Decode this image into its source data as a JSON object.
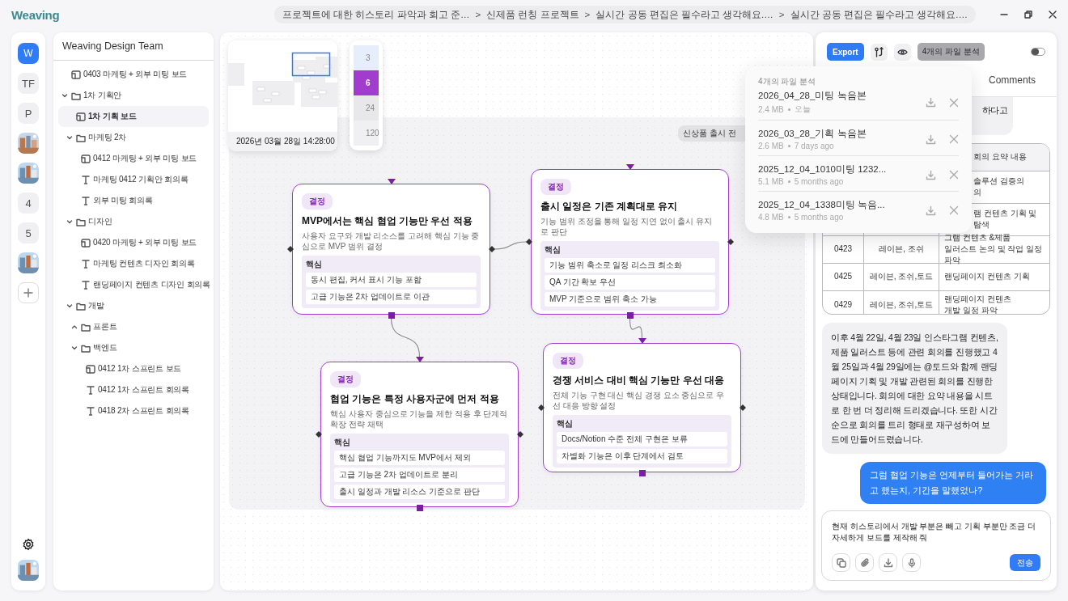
{
  "app": {
    "logo": "Weaving"
  },
  "breadcrumb": [
    {
      "label": "프로젝트에 대한 히스토리 파악과 회고 준…"
    },
    {
      "separator": ">",
      "label": "신제품 런칭 프로젝트"
    },
    {
      "separator": ">",
      "label": "실시간 공동 편집은 필수라고 생각해요.…"
    },
    {
      "separator": ">",
      "label": "실시간 공동 편집은 필수라고 생각해요.…"
    }
  ],
  "rail": {
    "items": [
      {
        "kind": "text",
        "label": "W",
        "selected": true
      },
      {
        "kind": "text",
        "label": "TF",
        "selected": false
      },
      {
        "kind": "text",
        "label": "P",
        "selected": false
      },
      {
        "kind": "picture",
        "selected": false
      },
      {
        "kind": "picture",
        "selected": false
      },
      {
        "kind": "text",
        "label": "4",
        "selected": false
      },
      {
        "kind": "text",
        "label": "5",
        "selected": false
      },
      {
        "kind": "picture",
        "selected": false
      },
      {
        "kind": "add"
      }
    ]
  },
  "tree": {
    "title": "Weaving Design Team",
    "items": [
      {
        "kind": "board",
        "label": "0403 마케팅 + 외부 미팅 보드",
        "selected": false
      },
      {
        "kind": "folder",
        "label": "1차 기획안",
        "expanded": true,
        "selected": false,
        "children": [
          {
            "kind": "board",
            "label": "1차 기획 보드",
            "selected": true
          },
          {
            "kind": "folder",
            "label": "마케팅 2차",
            "expanded": true,
            "selected": false,
            "children": [
              {
                "kind": "board",
                "label": "0412 마케팅 + 외부 미팅 보드",
                "selected": false
              },
              {
                "kind": "text",
                "label": "마케팅 0412 기획안 회의록",
                "selected": false
              },
              {
                "kind": "text",
                "label": "외부 미팅 회의록",
                "selected": false
              }
            ]
          },
          {
            "kind": "folder",
            "label": "디자인",
            "expanded": true,
            "selected": false,
            "children": [
              {
                "kind": "board",
                "label": "0420 마케팅 + 외부 미팅 보드",
                "selected": false
              },
              {
                "kind": "text",
                "label": "마케팅 컨텐츠 디자인 회의록",
                "selected": false
              },
              {
                "kind": "text",
                "label": "랜딩페이지 컨텐츠 디자인 회의록",
                "selected": false
              }
            ]
          },
          {
            "kind": "folder",
            "label": "개발",
            "expanded": true,
            "selected": false,
            "children": [
              {
                "kind": "folder",
                "label": "프론트",
                "expanded": false,
                "selected": false
              },
              {
                "kind": "folder",
                "label": "백엔드",
                "expanded": true,
                "selected": false,
                "children": [
                  {
                    "kind": "board",
                    "label": "0412 1차 스프린트 보드",
                    "selected": false
                  },
                  {
                    "kind": "text",
                    "label": "0412 1차 스프린트 회의록",
                    "selected": false
                  },
                  {
                    "kind": "text",
                    "label": "0418 2차 스프린트 회의록",
                    "selected": false
                  }
                ]
              }
            ]
          }
        ]
      }
    ]
  },
  "canvas": {
    "minimap": {
      "timestamp": "2026년 03월 28일 14:28:00"
    },
    "zoom_levels": [
      {
        "label": "3",
        "selected": false,
        "color": "#e6eefb"
      },
      {
        "label": "6",
        "selected": true,
        "color": "#a23ccf"
      },
      {
        "label": "24",
        "selected": false,
        "color": "#e8e8ea"
      },
      {
        "label": "120",
        "selected": false,
        "color": "#f0f0f2"
      }
    ],
    "section_label": "신상품 출시 전",
    "nodes": [
      {
        "tag": "결정",
        "title": "MVP에서는 핵심 협업 기능만 우선 적용",
        "description": "사용자 요구와 개발 리소스를 고려해 핵심 기능 중심으로 MVP 범위 결정",
        "key_label": "핵심",
        "key_points": [
          "동시 편집, 커서 표시 기능 포함",
          "고급 기능은 2차 업데이트로 이관"
        ]
      },
      {
        "tag": "결정",
        "title": "출시 일정은 기존 계획대로 유지",
        "description": "기능 범위 조정을 통해 일정 지연 없이 출시 유지로 판단",
        "key_label": "핵심",
        "key_points": [
          "기능 범위 축소로 일정 리스크 최소화",
          "QA 기간 확보 우선",
          "MVP 기준으로 범위 축소 가능"
        ]
      },
      {
        "tag": "결정",
        "title": "협업 기능은 특정 사용자군에 먼저 적용",
        "description": "핵심 사용자 중심으로 기능을 제한 적용 후 단계적 확장 전략 채택",
        "key_label": "핵심",
        "key_points": [
          "핵심 협업 기능까지도 MVP에서 제외",
          "고급 기능은 2차 업데이트로 분리",
          "출시 일정과 개발 리소스 기준으로 판단"
        ]
      },
      {
        "tag": "결정",
        "title": "경쟁 서비스 대비 핵심 기능만 우선 대응",
        "description": "전체 기능 구현 대신 핵심 경쟁 요소 중심으로 우선 대응 방향 설정",
        "key_label": "핵심",
        "key_points": [
          "Docs/Notion 수준 전체 구현은 보류",
          "차별화 기능은 이후 단계에서 검토"
        ]
      }
    ]
  },
  "right_panel": {
    "toolbar": {
      "export": "Export",
      "files_chip": {
        "label": "4개의 파일 분석",
        "active": true
      },
      "toggle": {
        "on": false
      }
    },
    "tabs": [
      {
        "label": "Comments",
        "selected": false
      }
    ],
    "messages": [
      {
        "kind": "ai_message",
        "text": "하다고"
      },
      {
        "kind": "table",
        "header": {
          "column_3": "회의 요약 내용"
        },
        "rows": [
          {
            "column_3": "솔루션 검증의\n의"
          },
          {
            "column_3": "램 컨텐츠 기획 및\n탐색"
          },
          {
            "column_1": "0423",
            "column_2": "레이븐, 조쉬",
            "column_3": "그램 컨텐츠 &제품\n일러스트 논의 및 작업 일정 파악"
          },
          {
            "column_1": "0425",
            "column_2": "레이븐, 조쉬,토드",
            "column_3": "랜딩페이지 컨텐츠 기획"
          },
          {
            "column_1": "0429",
            "column_2": "레이븐, 조쉬,토드",
            "column_3": "랜딩페이지 컨텐츠\n개발 일정 파악"
          }
        ]
      },
      {
        "kind": "ai_message",
        "text": "이후 4월 22일, 4월 23일 인스타그램 컨텐츠, 제품 일러스트 등에 관련 회의를 진행했고 4월 25일과 4월 29일에는 @토드와 함께 랜딩페이지 기획 및 개발 관련된 회의를 진행한 상태입니다. 회의에 대한 요약 내용을 시트로 한 번 더 정리해 드리겠습니다. 또한 시간순으로 회의를 트리 형태로 재구성하여 보드에 만들어드렸습니다."
      },
      {
        "kind": "user_message",
        "text": "그럼 협업 기능은 언제부터 들어가는 거라고 했는지, 기간을 말했었나?"
      }
    ],
    "composer": {
      "value": "현재 히스토리에서 개발 부분은 빼고 기획 부분만 조금 더 자세하게 보드를 제작해 줘",
      "send": "전송"
    }
  },
  "file_popup": {
    "title": "4개의 파일 분석",
    "files": [
      {
        "name": "2026_04_28_미팅 녹음본",
        "size": "2.4 MB",
        "age": "오늘"
      },
      {
        "name": "2026_03_28_기획 녹음본",
        "size": "2.6 MB",
        "age": "7 days ago"
      },
      {
        "name": "2025_12_04_1010미팅 1232...",
        "size": "5.1 MB",
        "age": "5 months ago"
      },
      {
        "name": "2025_12_04_1338미팅 녹음...",
        "size": "4.8 MB",
        "age": "5 months ago"
      }
    ]
  }
}
